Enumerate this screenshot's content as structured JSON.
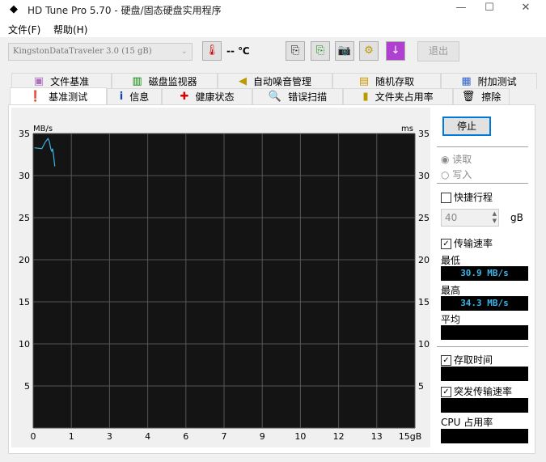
{
  "window": {
    "title": "HD Tune Pro 5.70 - 硬盘/固态硬盘实用程序",
    "minimize": "—",
    "maximize": "☐",
    "close": "✕"
  },
  "menu": [
    "文件(F)",
    "帮助(H)"
  ],
  "toolbar": {
    "drive": "KingstonDataTraveler 3.0 (15 gB)",
    "temperature": "-- ℃",
    "exit_label": "退出"
  },
  "tabs_row1": [
    {
      "label": "文件基准",
      "icon": "file-benchmark-icon"
    },
    {
      "label": "磁盘监视器",
      "icon": "disk-monitor-icon"
    },
    {
      "label": "自动噪音管理",
      "icon": "speaker-icon"
    },
    {
      "label": "随机存取",
      "icon": "random-access-icon"
    },
    {
      "label": "附加测试",
      "icon": "extra-tests-icon"
    }
  ],
  "tabs_row2": [
    {
      "label": "基准测试",
      "icon": "benchmark-icon",
      "active": true
    },
    {
      "label": "信息",
      "icon": "info-icon"
    },
    {
      "label": "健康状态",
      "icon": "health-icon"
    },
    {
      "label": "错误扫描",
      "icon": "error-scan-icon"
    },
    {
      "label": "文件夹占用率",
      "icon": "folder-icon"
    },
    {
      "label": "擦除",
      "icon": "erase-icon"
    }
  ],
  "side": {
    "stop_label": "停止",
    "read_label": "读取",
    "write_label": "写入",
    "short_stroke_label": "快捷行程",
    "short_stroke_value": "40",
    "short_stroke_unit": "gB",
    "transfer_rate_label": "传输速率",
    "min_label": "最低",
    "min_value": "30.9 MB/s",
    "max_label": "最高",
    "max_value": "34.3 MB/s",
    "avg_label": "平均",
    "avg_value": "",
    "access_time_label": "存取时间",
    "burst_rate_label": "突发传输速率",
    "cpu_label": "CPU 占用率"
  },
  "chart_data": {
    "type": "line",
    "ylabel_left": "MB/s",
    "ylabel_right": "ms",
    "xlim": [
      0,
      15
    ],
    "ylim": [
      0,
      35
    ],
    "x_unit": "gB",
    "x_ticks": [
      "0",
      "1",
      "3",
      "4",
      "6",
      "7",
      "9",
      "10",
      "12",
      "13",
      "15gB"
    ],
    "y_ticks": [
      "5",
      "10",
      "15",
      "20",
      "25",
      "30",
      "35"
    ],
    "grid": true,
    "line_color": "#3cb4e6",
    "series": [
      {
        "x": [
          0.05,
          0.34,
          0.48,
          0.58,
          0.63,
          0.69,
          0.73,
          0.76,
          0.79,
          0.85
        ],
        "y": [
          33.3,
          33.2,
          34.0,
          34.4,
          34.1,
          33.2,
          32.9,
          33.2,
          32.7,
          31.1
        ]
      }
    ]
  }
}
